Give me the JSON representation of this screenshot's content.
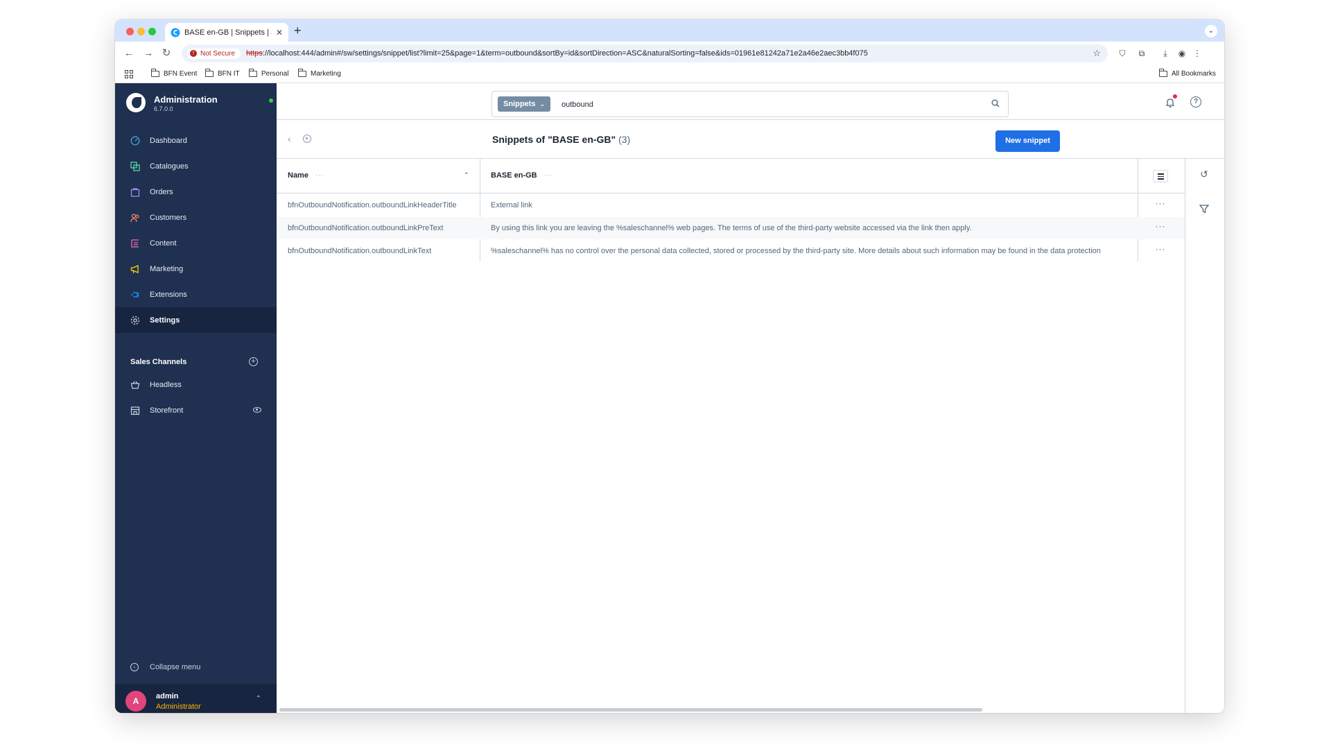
{
  "browser": {
    "tab_title": "BASE en-GB | Snippets | Shop",
    "not_secure": "Not Secure",
    "url_scheme": "https",
    "url_rest": "://localhost:444/admin#/sw/settings/snippet/list?limit=25&page=1&term=outbound&sortBy=id&sortDirection=ASC&naturalSorting=false&ids=01961e81242a71e2a46e2aec3bb4f075",
    "bookmarks": [
      "BFN Event",
      "BFN IT",
      "Personal",
      "Marketing"
    ],
    "all_bookmarks": "All Bookmarks"
  },
  "sidebar": {
    "title": "Administration",
    "version": "6.7.0.0",
    "items": [
      {
        "label": "Dashboard"
      },
      {
        "label": "Catalogues"
      },
      {
        "label": "Orders"
      },
      {
        "label": "Customers"
      },
      {
        "label": "Content"
      },
      {
        "label": "Marketing"
      },
      {
        "label": "Extensions"
      },
      {
        "label": "Settings"
      }
    ],
    "sales_channels_label": "Sales Channels",
    "sales_channels": [
      {
        "label": "Headless"
      },
      {
        "label": "Storefront"
      }
    ],
    "collapse_label": "Collapse menu",
    "user": {
      "initial": "A",
      "name": "admin",
      "role": "Administrator"
    }
  },
  "search": {
    "type_label": "Snippets",
    "value": "outbound"
  },
  "page": {
    "title": "Snippets of \"BASE en-GB\"",
    "count": "(3)",
    "new_button": "New snippet"
  },
  "grid": {
    "columns": [
      "Name",
      "BASE en-GB"
    ],
    "rows": [
      {
        "name": "bfnOutboundNotification.outboundLinkHeaderTitle",
        "value": "External link"
      },
      {
        "name": "bfnOutboundNotification.outboundLinkPreText",
        "value": "By using this link you are leaving the %saleschannel% web pages. The terms of use of the third-party website accessed via the link then apply."
      },
      {
        "name": "bfnOutboundNotification.outboundLinkText",
        "value": "%saleschannel% has no control over the personal data collected, stored or processed by the third-party site. More details about such information may be found in the data protection"
      }
    ]
  },
  "colors": {
    "sidebar_bg": "#1f3050",
    "primary_button": "#1f6fe5",
    "role_text": "#ffb200",
    "avatar": "#e0457b"
  }
}
